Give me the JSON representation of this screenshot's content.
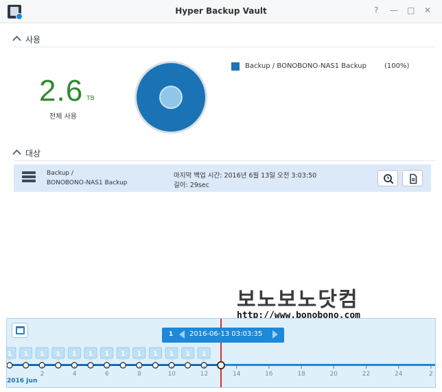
{
  "window": {
    "title": "Hyper Backup Vault",
    "controls": {
      "help": "?",
      "minimize": "—",
      "maximize": "□",
      "close": "✕"
    }
  },
  "usage": {
    "header": "사용",
    "total_value": "2.6",
    "total_unit": "TB",
    "total_label": "전체 사용",
    "legend": [
      {
        "label": "Backup / BONOBONO-NAS1 Backup",
        "percent": "(100%)",
        "color": "#1a73b5"
      }
    ],
    "pie_fraction": 1.0
  },
  "target": {
    "header": "대상",
    "rows": [
      {
        "name_line1": "Backup /",
        "name_line2": "BONOBONO-NAS1 Backup",
        "last_backup": "마지막 백업 시간: 2016년 6월 13일 오전 3:03:50",
        "duration": "길이: 29sec"
      }
    ],
    "buttons": [
      "backup-explorer-icon",
      "log-icon"
    ]
  },
  "watermark": {
    "title": "보노보노닷컴",
    "url": "http://www.bonobono.com"
  },
  "timeline": {
    "selected_count": "1",
    "selected_date": "2016-06-13 03:03:35",
    "month_label": "2016 Jun",
    "day_labels": [
      "2",
      "4",
      "6",
      "8",
      "10",
      "12",
      "14",
      "16",
      "18",
      "20",
      "22",
      "24",
      "2"
    ],
    "version_counts": [
      "1",
      "1",
      "1",
      "1",
      "1",
      "1",
      "1",
      "1",
      "1",
      "1",
      "1",
      "1",
      "1"
    ],
    "accent_color": "#1e88d9",
    "marker_color": "#d32f2f"
  }
}
